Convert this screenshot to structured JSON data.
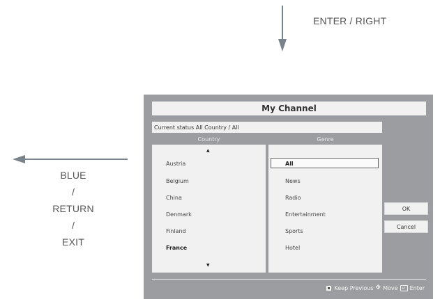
{
  "annotations": {
    "enter_right": "ENTER / RIGHT",
    "left_lines": [
      "BLUE",
      "/",
      "RETURN",
      "/",
      "EXIT"
    ]
  },
  "dialog": {
    "title": "My Channel",
    "status": "Current status All Country / All",
    "country_header": "Country",
    "genre_header": "Genre",
    "countries": [
      "Austria",
      "Belgium",
      "China",
      "Denmark",
      "Finland",
      "France"
    ],
    "genres": [
      "All",
      "News",
      "Radio",
      "Entertainment",
      "Sports",
      "Hotel"
    ],
    "selected_genre": "All",
    "highlighted_country": "France",
    "buttons": {
      "ok": "OK",
      "cancel": "Cancel"
    },
    "footer": {
      "keep_previous": "Keep Previous",
      "move": "Move",
      "enter": "Enter"
    }
  },
  "colors": {
    "dialog_bg": "#9b9da0",
    "panel_bg": "#f1f1f2",
    "annotation_text": "#555555",
    "arrow": "#7a828c"
  },
  "icons": [
    "scroll-up-icon",
    "scroll-down-icon",
    "keep-previous-icon",
    "move-icon",
    "enter-icon",
    "arrow-down-icon",
    "arrow-left-icon"
  ]
}
